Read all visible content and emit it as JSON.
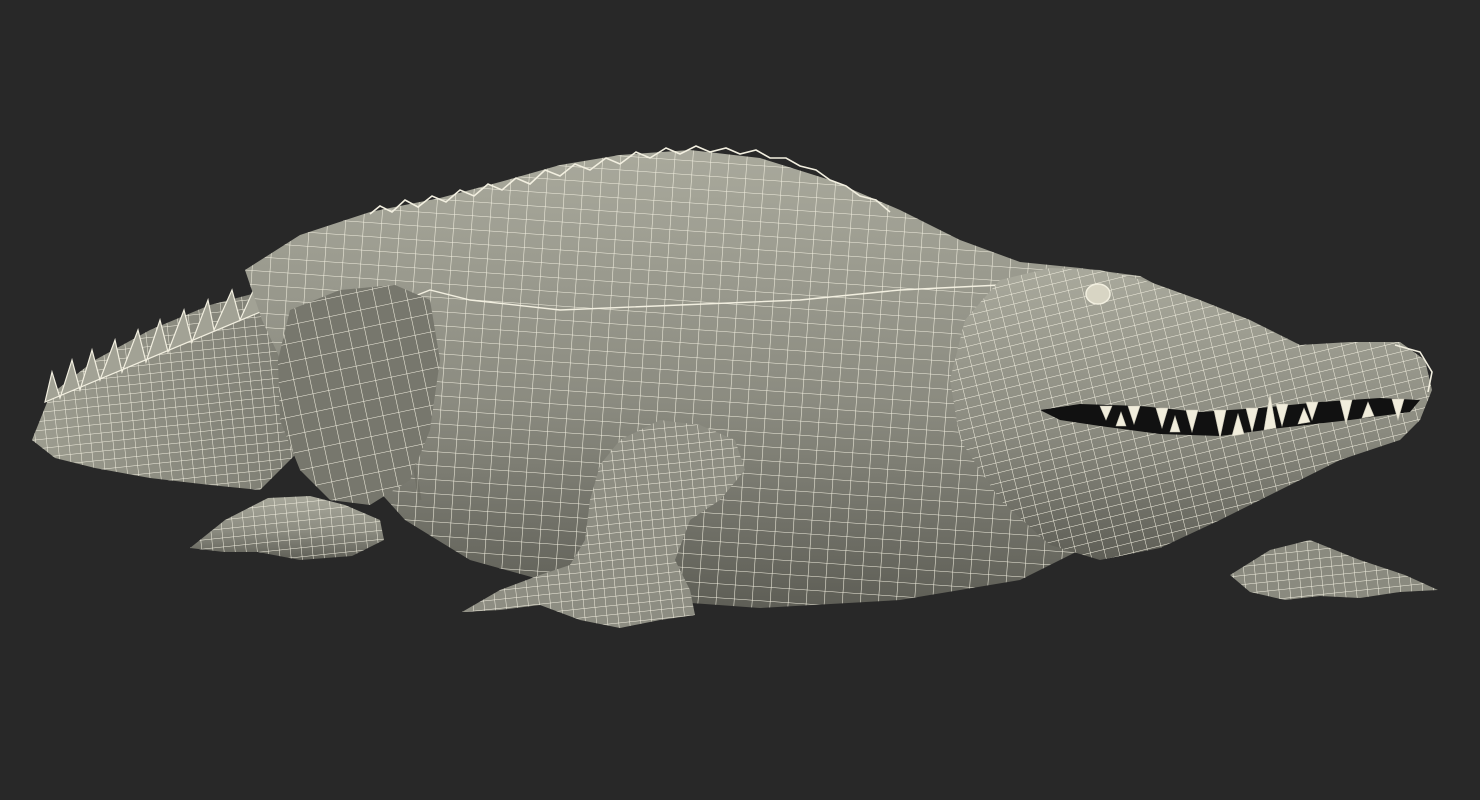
{
  "scene": {
    "subject": "crocodile-wireframe-model",
    "colors": {
      "background": "#282828",
      "surface": "#8b8b80",
      "surface_light": "#a9a99c",
      "surface_dark": "#5e5e56",
      "wire": "#f2efe0",
      "teeth": "#f1eddc",
      "mouth": "#111111"
    }
  }
}
